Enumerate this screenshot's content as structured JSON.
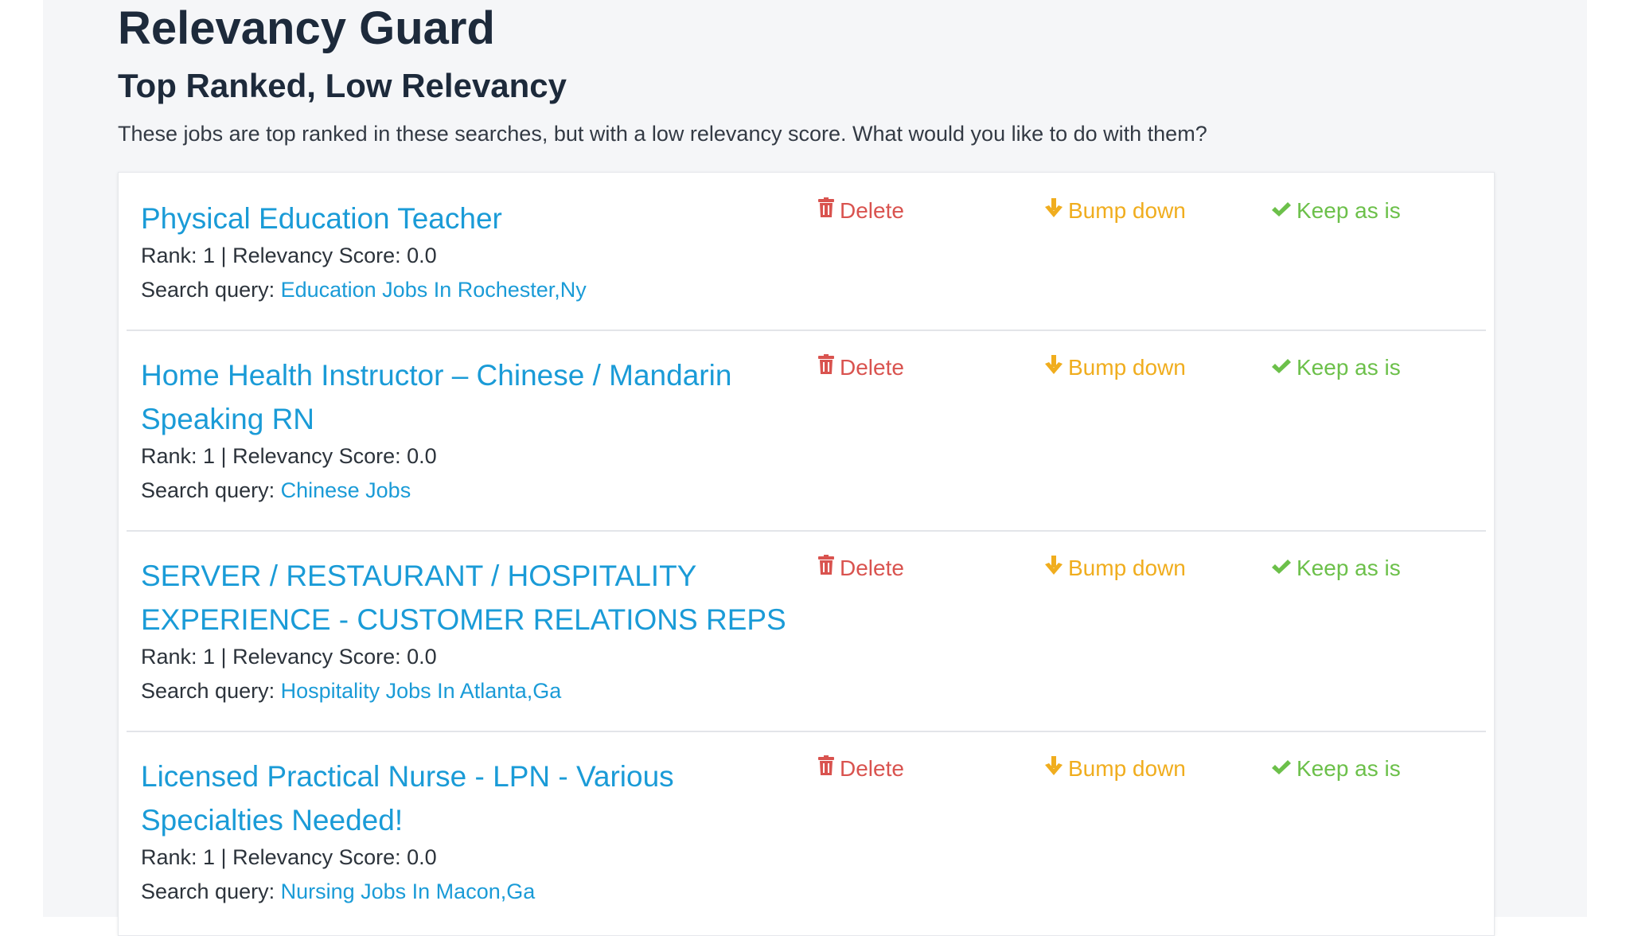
{
  "page": {
    "title": "Relevancy Guard",
    "subtitle": "Top Ranked, Low Relevancy",
    "description": "These jobs are top ranked in these searches, but with a low relevancy score. What would you like to do with them?"
  },
  "actions": {
    "delete_label": "Delete",
    "bump_label": "Bump down",
    "keep_label": "Keep as is",
    "delete_icon": "trash-icon",
    "bump_icon": "arrow-down-icon",
    "keep_icon": "check-icon"
  },
  "colors": {
    "link": "#1a9bd7",
    "delete": "#d9534f",
    "bump": "#f0ad1e",
    "keep": "#6cc04a",
    "heading": "#1d2a3b"
  },
  "jobs": [
    {
      "title": "Physical Education Teacher",
      "rank_line": "Rank: 1 | Relevancy Score: 0.0",
      "query_label": "Search query: ",
      "query": "Education Jobs In Rochester,Ny"
    },
    {
      "title": "Home Health Instructor – Chinese / Mandarin Speaking RN",
      "rank_line": "Rank: 1 | Relevancy Score: 0.0",
      "query_label": "Search query: ",
      "query": "Chinese Jobs"
    },
    {
      "title": "SERVER / RESTAURANT / HOSPITALITY EXPERIENCE - CUSTOMER RELATIONS REPS",
      "rank_line": "Rank: 1 | Relevancy Score: 0.0",
      "query_label": "Search query: ",
      "query": "Hospitality Jobs In Atlanta,Ga"
    },
    {
      "title": "Licensed Practical Nurse - LPN - Various Specialties Needed!",
      "rank_line": "Rank: 1 | Relevancy Score: 0.0",
      "query_label": "Search query: ",
      "query": "Nursing Jobs In Macon,Ga"
    }
  ]
}
